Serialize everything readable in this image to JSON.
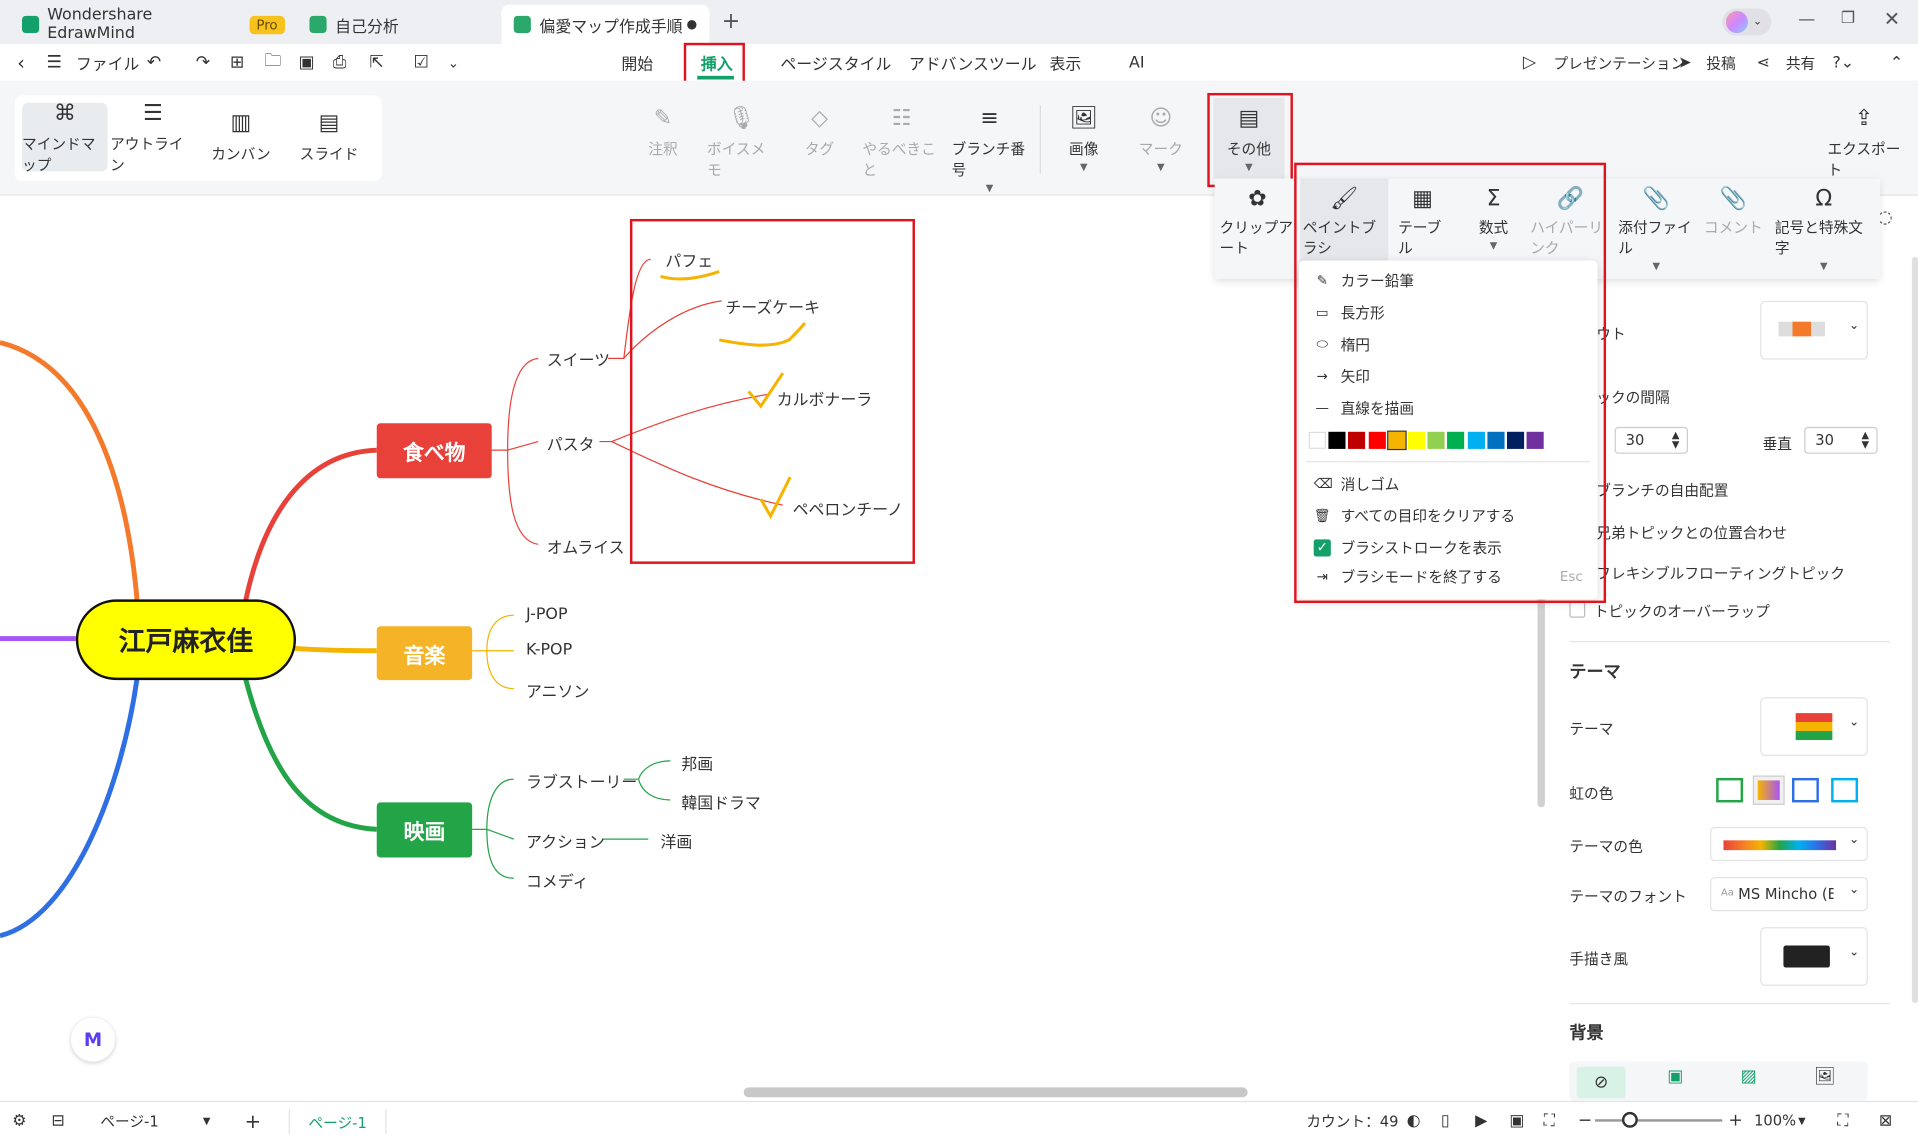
{
  "tabs": [
    {
      "label": "Wondershare EdrawMind",
      "badge": "Pro"
    },
    {
      "label": "自己分析"
    },
    {
      "label": "偏愛マップ作成手順"
    }
  ],
  "menu": {
    "file": "ファイル",
    "ribbon_tabs": [
      "開始",
      "挿入",
      "ページスタイル",
      "アドバンスツール",
      "表示",
      "AI"
    ],
    "active_tab": "挿入",
    "presentation": "プレゼンテーション",
    "publish": "投稿",
    "share": "共有"
  },
  "views": [
    "マインドマップ",
    "アウトライン",
    "カンバン",
    "スライド"
  ],
  "ribbon": {
    "annotation": "注釈",
    "voice_memo": "ボイスメモ",
    "tag": "タグ",
    "todo": "やるべきこと",
    "branch_number": "ブランチ番号",
    "image": "画像",
    "mark": "マーク",
    "other": "その他",
    "export": "エクスポート"
  },
  "submenu": [
    "クリップアート",
    "ペイントブラシ",
    "テーブル",
    "数式",
    "ハイパーリンク",
    "添付ファイル",
    "コメント",
    "記号と特殊文字"
  ],
  "dropdown": {
    "items": [
      "カラー鉛筆",
      "長方形",
      "楕円",
      "矢印",
      "直線を描画"
    ],
    "colors": [
      "#ffffff",
      "#000000",
      "#c00000",
      "#ff0000",
      "#f5b400",
      "#ffff00",
      "#92d050",
      "#00b050",
      "#00b0f0",
      "#0070c0",
      "#002060",
      "#7030a0"
    ],
    "eraser": "消しゴム",
    "clear_all": "すべての目印をクリアする",
    "show_strokes": "ブラシストロークを表示",
    "exit_brush": "ブラシモードを終了する",
    "exit_key": "Esc"
  },
  "mindmap": {
    "center": "江戸麻衣佳",
    "food": "食べ物",
    "sweets": "スイーツ",
    "parfait": "パフェ",
    "cheesecake": "チーズケーキ",
    "pasta": "パスタ",
    "carbonara": "カルボナーラ",
    "peperoncino": "ペペロンチーノ",
    "omurice": "オムライス",
    "music": "音楽",
    "jpop": "J-POP",
    "kpop": "K-POP",
    "anison": "アニソン",
    "movie": "映画",
    "lovestory": "ラブストーリー",
    "houga": "邦画",
    "kdrama": "韓国ドラマ",
    "action": "アクション",
    "youga": "洋画",
    "comedy": "コメディ"
  },
  "panel": {
    "layout_partial": "ウト",
    "spacing_partial": "ックの間隔",
    "horizontal_value": "30",
    "vertical_label": "垂直",
    "vertical_value": "30",
    "free_branch": "ブランチの自由配置",
    "align_sibling": "兄弟トピックとの位置合わせ",
    "flexible_float": "フレキシブルフローティングトピック",
    "topic_overlap": "トピックのオーバーラップ",
    "theme_header": "テーマ",
    "theme_label": "テーマ",
    "rainbow": "虹の色",
    "theme_color": "テーマの色",
    "theme_font": "テーマのフォント",
    "font_value": "MS Mincho (Big",
    "handdrawn": "手描き風",
    "background": "背景"
  },
  "status": {
    "page_select": "ページ-1",
    "page_tab": "ページ-1",
    "count": "カウント：49",
    "zoom": "100%"
  }
}
